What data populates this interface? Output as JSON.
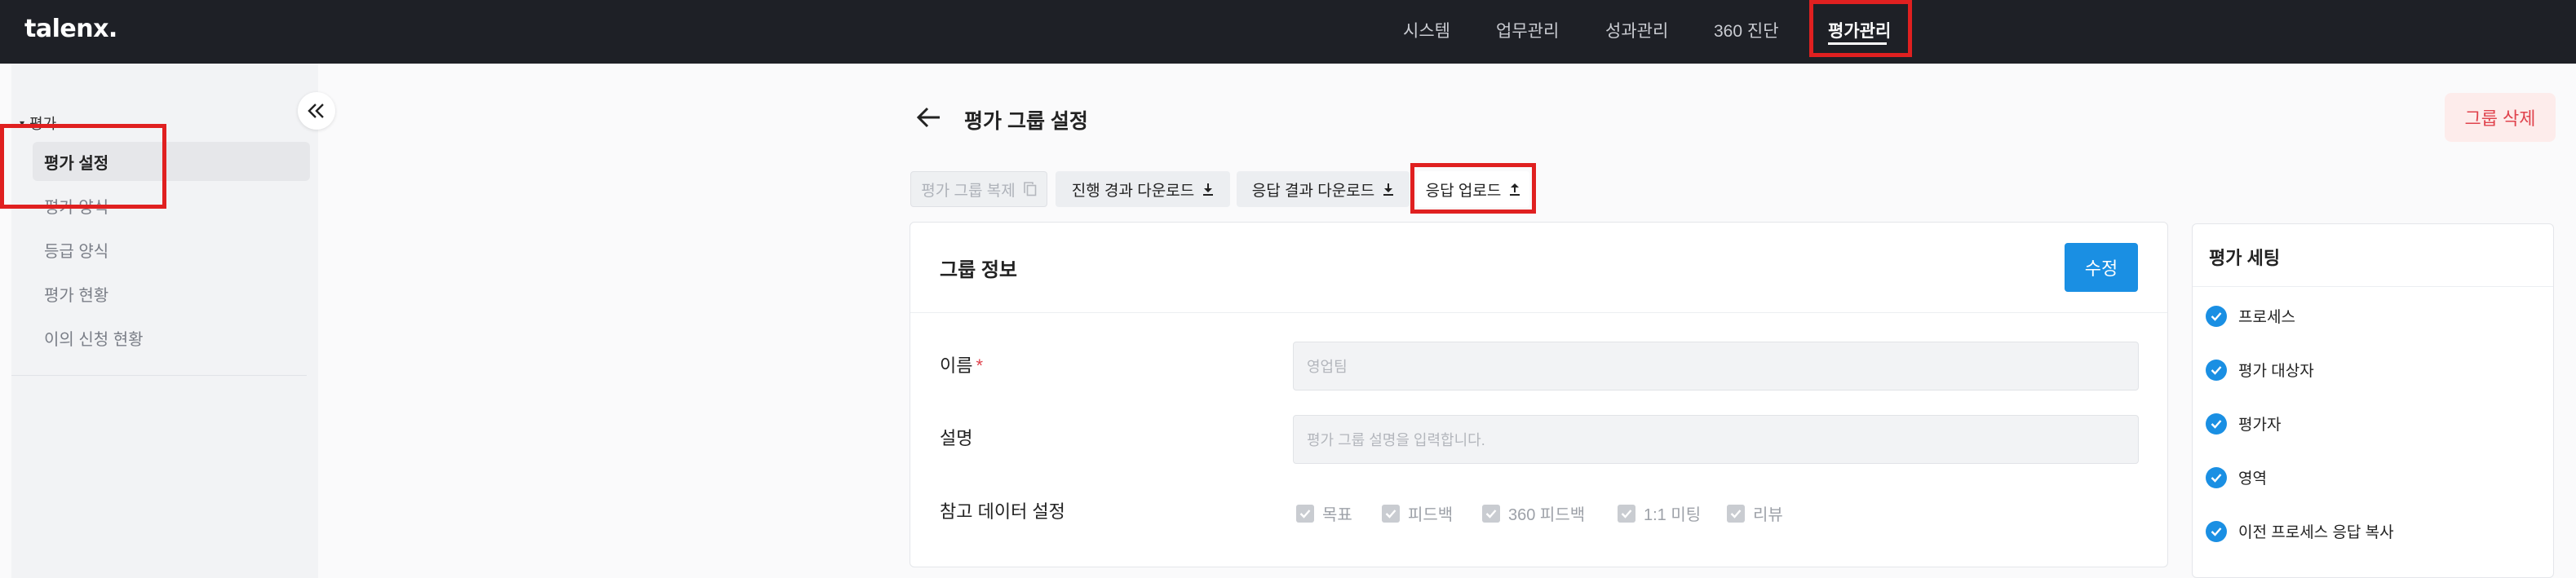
{
  "brand": {
    "logo": "talenx."
  },
  "topnav": {
    "items": [
      {
        "label": "시스템"
      },
      {
        "label": "업무관리"
      },
      {
        "label": "성과관리"
      },
      {
        "label": "360 진단"
      },
      {
        "label": "평가관리"
      }
    ],
    "active_index": 4
  },
  "sidebar": {
    "group_label": "평가",
    "items": [
      {
        "label": "평가 설정"
      },
      {
        "label": "평가 양식"
      },
      {
        "label": "등급 양식"
      },
      {
        "label": "평가 현황"
      },
      {
        "label": "이의 신청 현황"
      }
    ],
    "active_index": 0
  },
  "header": {
    "title": "평가 그룹 설정",
    "delete_label": "그룹 삭제"
  },
  "toolbar": {
    "copy_label": "평가 그룹 복제",
    "progress_download_label": "진행 경과 다운로드",
    "response_download_label": "응답 결과 다운로드",
    "response_upload_label": "응답 업로드"
  },
  "group_info": {
    "title": "그룹 정보",
    "edit_label": "수정",
    "name_label": "이름",
    "required_mark": "*",
    "name_value": "영업팀",
    "description_label": "설명",
    "description_placeholder": "평가 그룹 설명을 입력합니다.",
    "reference_label": "참고 데이터 설정",
    "reference_options": [
      {
        "label": "목표",
        "checked": true
      },
      {
        "label": "피드백",
        "checked": true
      },
      {
        "label": "360 피드백",
        "checked": true
      },
      {
        "label": "1:1 미팅",
        "checked": true
      },
      {
        "label": "리뷰",
        "checked": true
      }
    ]
  },
  "settings": {
    "title": "평가 세팅",
    "steps": [
      {
        "label": "프로세스",
        "done": true
      },
      {
        "label": "평가 대상자",
        "done": true
      },
      {
        "label": "평가자",
        "done": true
      },
      {
        "label": "영역",
        "done": true
      },
      {
        "label": "이전 프로세스 응답 복사",
        "done": true
      }
    ]
  },
  "colors": {
    "nav_bg": "#1e2026",
    "accent_blue": "#1a8fe3",
    "danger": "#e0434d",
    "highlight_red": "#e02020"
  }
}
